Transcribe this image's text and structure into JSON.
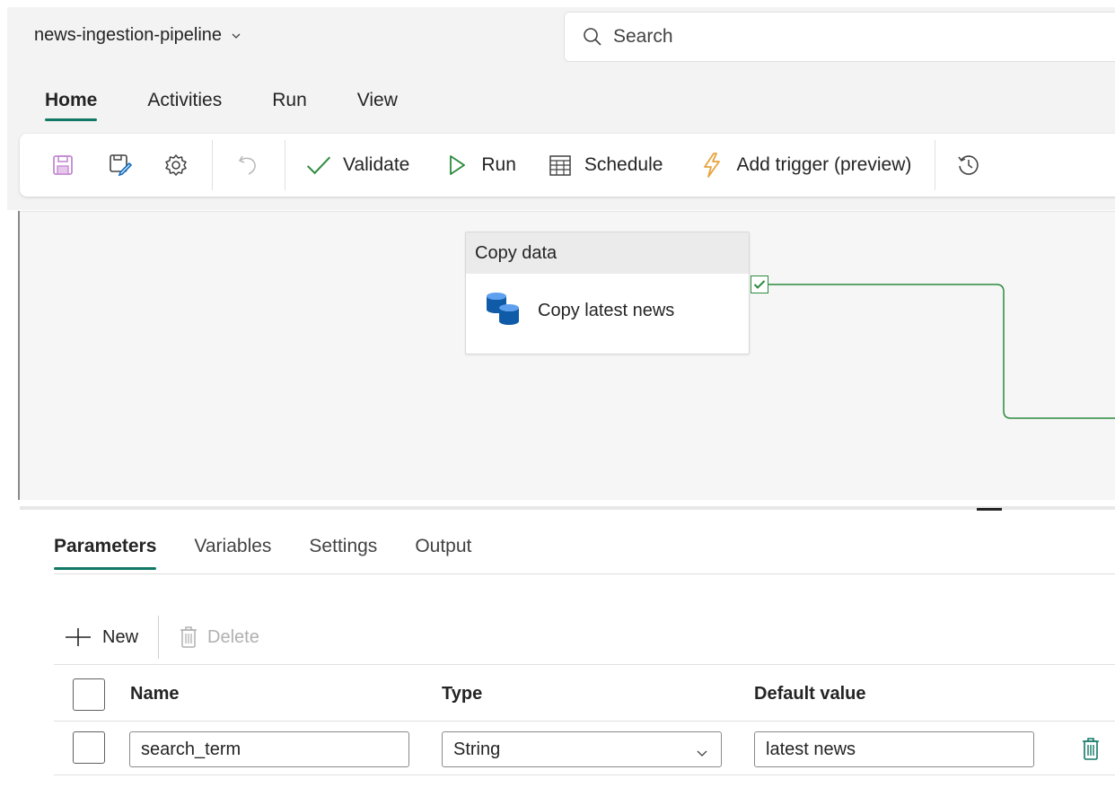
{
  "app": {
    "pipeline_name": "news-ingestion-pipeline",
    "search_placeholder": "Search"
  },
  "ribbon": {
    "tabs": [
      {
        "label": "Home",
        "active": true
      },
      {
        "label": "Activities",
        "active": false
      },
      {
        "label": "Run",
        "active": false
      },
      {
        "label": "View",
        "active": false
      }
    ],
    "toolbar": {
      "save_icon": "save-icon",
      "save_as_icon": "save-as-icon",
      "settings_icon": "gear-icon",
      "undo_icon": "undo-icon",
      "validate_label": "Validate",
      "run_label": "Run",
      "schedule_label": "Schedule",
      "add_trigger_label": "Add trigger (preview)",
      "history_icon": "history-icon"
    }
  },
  "canvas": {
    "activity": {
      "type_label": "Copy data",
      "name": "Copy latest news",
      "icon": "copy-data-icon",
      "status": "success"
    }
  },
  "bottom_panel": {
    "tabs": [
      {
        "label": "Parameters",
        "active": true
      },
      {
        "label": "Variables",
        "active": false
      },
      {
        "label": "Settings",
        "active": false
      },
      {
        "label": "Output",
        "active": false
      }
    ],
    "new_label": "New",
    "delete_label": "Delete",
    "columns": [
      "Name",
      "Type",
      "Default value"
    ],
    "rows": [
      {
        "name": "search_term",
        "type": "String",
        "default_value": "latest news"
      }
    ]
  },
  "colors": {
    "accent": "#117865",
    "success": "#2b8a3e",
    "trigger": "#e8a33d",
    "save_disabled": "#c38bd0"
  }
}
